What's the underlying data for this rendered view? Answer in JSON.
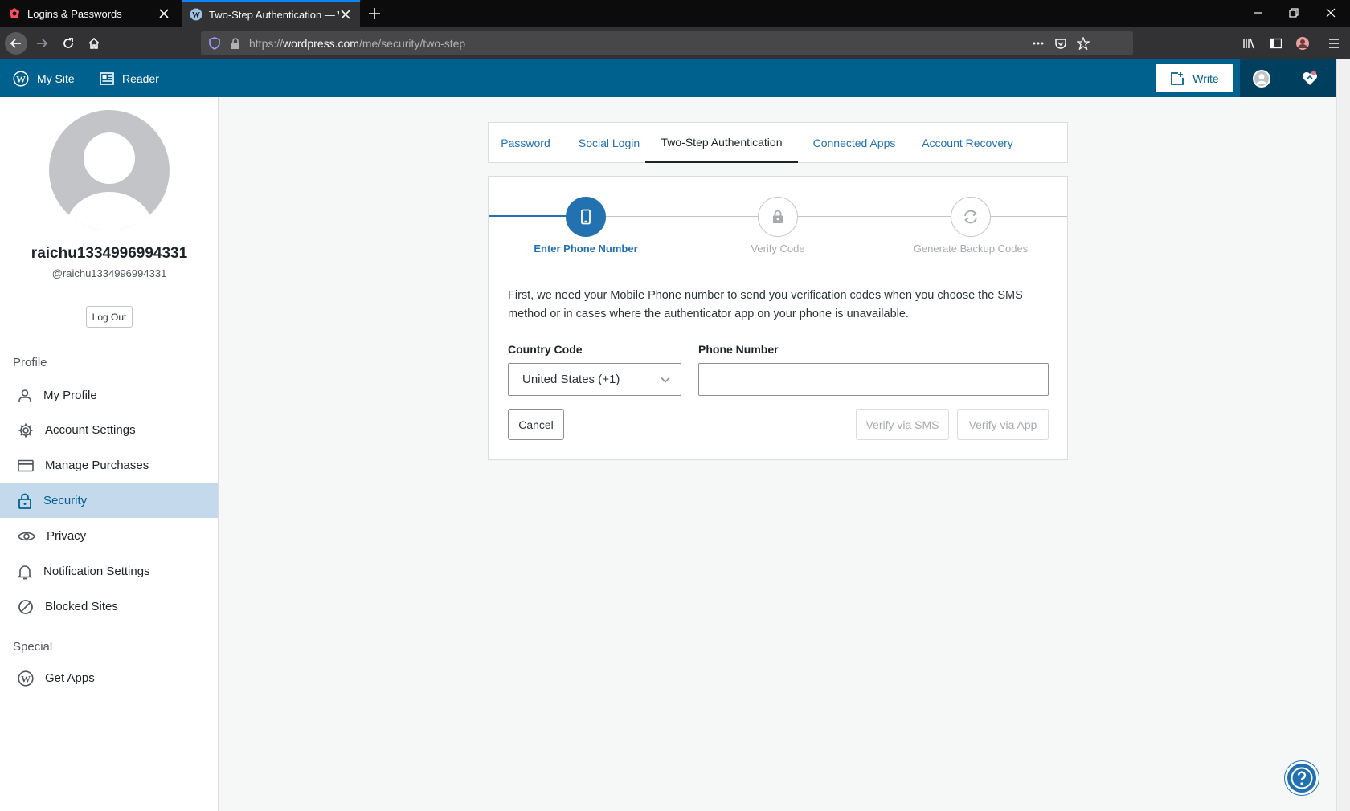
{
  "browser": {
    "tabs": [
      {
        "title": "Logins & Passwords",
        "active": false
      },
      {
        "title": "Two-Step Authentication — W",
        "active": true
      }
    ],
    "url_prefix": "https://",
    "url_domain": "wordpress.com",
    "url_path": "/me/security/two-step"
  },
  "masterbar": {
    "my_site": "My Site",
    "reader": "Reader",
    "write": "Write",
    "color": "#00618e"
  },
  "profile": {
    "username": "raichu1334996994331",
    "handle": "@raichu1334996994331",
    "logout": "Log Out"
  },
  "sidebar": {
    "profile_heading": "Profile",
    "items": [
      {
        "label": "My Profile",
        "icon": "person-icon"
      },
      {
        "label": "Account Settings",
        "icon": "gear-icon"
      },
      {
        "label": "Manage Purchases",
        "icon": "credit-card-icon"
      },
      {
        "label": "Security",
        "icon": "lock-icon",
        "active": true
      },
      {
        "label": "Privacy",
        "icon": "eye-icon"
      },
      {
        "label": "Notification Settings",
        "icon": "bell-icon"
      },
      {
        "label": "Blocked Sites",
        "icon": "block-icon"
      }
    ],
    "special_heading": "Special",
    "special_items": [
      {
        "label": "Get Apps",
        "icon": "wordpress-icon"
      }
    ]
  },
  "security_tabs": [
    {
      "label": "Password"
    },
    {
      "label": "Social Login"
    },
    {
      "label": "Two-Step Authentication",
      "active": true
    },
    {
      "label": "Connected Apps"
    },
    {
      "label": "Account Recovery"
    }
  ],
  "steps": [
    {
      "label": "Enter Phone Number",
      "icon": "phone-icon",
      "active": true
    },
    {
      "label": "Verify Code",
      "icon": "lock-icon"
    },
    {
      "label": "Generate Backup Codes",
      "icon": "refresh-icon"
    }
  ],
  "form": {
    "intro": "First, we need your Mobile Phone number to send you verification codes when you choose the SMS method or in cases where the authenticator app on your phone is unavailable.",
    "country_label": "Country Code",
    "country_value": "United States (+1)",
    "phone_label": "Phone Number",
    "phone_value": "",
    "cancel": "Cancel",
    "verify_sms": "Verify via SMS",
    "verify_app": "Verify via App"
  }
}
